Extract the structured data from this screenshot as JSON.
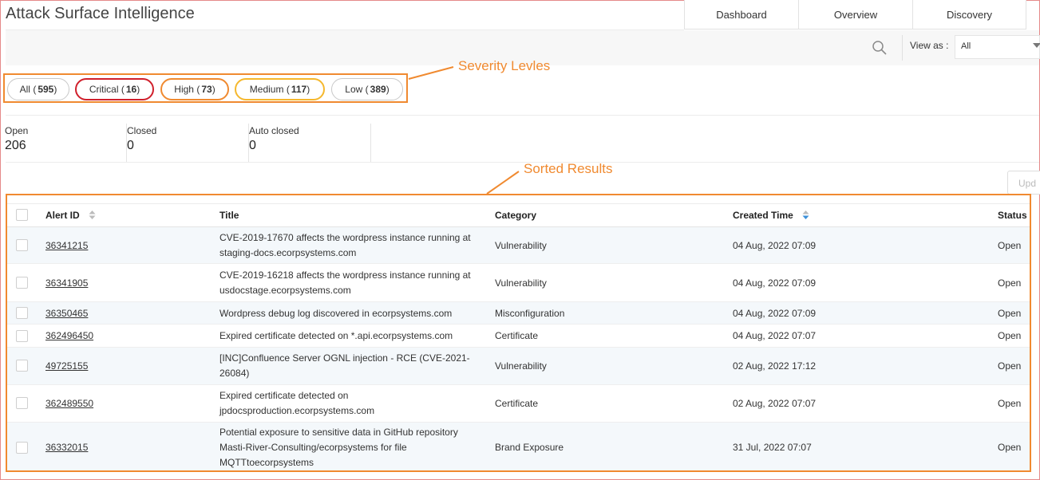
{
  "app": {
    "title": "Attack Surface Intelligence"
  },
  "nav": {
    "tabs": [
      {
        "label": "Dashboard"
      },
      {
        "label": "Overview"
      },
      {
        "label": "Discovery"
      }
    ]
  },
  "toolbar": {
    "search_icon": "search-icon",
    "view_as_label": "View as :",
    "view_as_value": "All"
  },
  "severity": {
    "pills": [
      {
        "name": "All",
        "count": "595",
        "color": "#c8c8c8"
      },
      {
        "name": "Critical",
        "count": "16",
        "color": "#d0202c"
      },
      {
        "name": "High",
        "count": "73",
        "color": "#f08a30"
      },
      {
        "name": "Medium",
        "count": "117",
        "color": "#f5b82e"
      },
      {
        "name": "Low",
        "count": "389",
        "color": "#c8c8c8"
      }
    ]
  },
  "annotations": {
    "severity_label": "Severity Levles",
    "results_label": "Sorted Results",
    "color": "#f08a30"
  },
  "counters": [
    {
      "label": "Open",
      "value": "206"
    },
    {
      "label": "Closed",
      "value": "0"
    },
    {
      "label": "Auto closed",
      "value": "0"
    }
  ],
  "update_button": {
    "label": "Upd"
  },
  "table": {
    "columns": {
      "alert_id": "Alert ID",
      "title": "Title",
      "category": "Category",
      "created_time": "Created Time",
      "status": "Status"
    },
    "rows": [
      {
        "alert_id": "36341215",
        "title_lines": [
          "CVE-2019-17670 affects the wordpress instance running at",
          "staging-docs.ecorpsystems.com"
        ],
        "category": "Vulnerability",
        "created": "04 Aug, 2022 07:09",
        "status": "Open"
      },
      {
        "alert_id": "36341905",
        "title_lines": [
          "CVE-2019-16218 affects the wordpress instance running at",
          "usdocstage.ecorpsystems.com"
        ],
        "category": "Vulnerability",
        "created": "04 Aug, 2022 07:09",
        "status": "Open"
      },
      {
        "alert_id": "36350465",
        "title_lines": [
          "Wordpress debug log discovered in ecorpsystems.com"
        ],
        "category": "Misconfiguration",
        "created": "04 Aug, 2022 07:09",
        "status": "Open"
      },
      {
        "alert_id": "362496450",
        "title_lines": [
          "Expired certificate detected on *.api.ecorpsystems.com"
        ],
        "category": "Certificate",
        "created": "04 Aug, 2022 07:07",
        "status": "Open"
      },
      {
        "alert_id": "49725155",
        "title_lines": [
          "[INC]Confluence Server OGNL injection - RCE (CVE-2021-",
          "26084)"
        ],
        "category": "Vulnerability",
        "created": "02 Aug, 2022 17:12",
        "status": "Open"
      },
      {
        "alert_id": "362489550",
        "title_lines": [
          "Expired certificate detected on",
          "jpdocsproduction.ecorpsystems.com"
        ],
        "category": "Certificate",
        "created": "02 Aug, 2022 07:07",
        "status": "Open"
      },
      {
        "alert_id": "36332015",
        "title_lines": [
          "Potential exposure to sensitive data in GitHub repository",
          "Masti-River-Consulting/ecorpsystems for file",
          "MQTTtoecorpsystems"
        ],
        "category": "Brand Exposure",
        "created": "31 Jul, 2022 07:07",
        "status": "Open"
      }
    ]
  }
}
